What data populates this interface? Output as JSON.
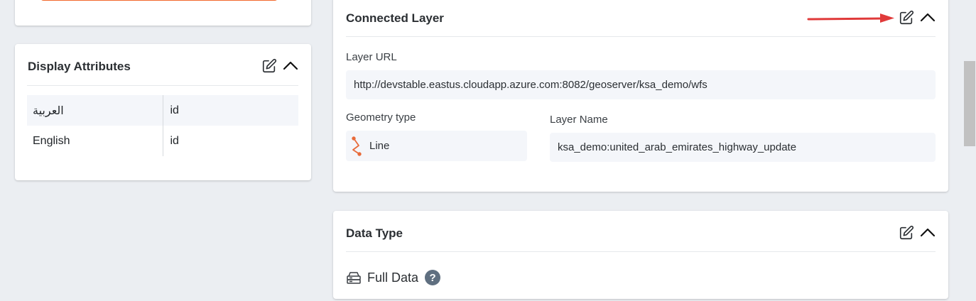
{
  "display_attributes": {
    "title": "Display Attributes",
    "rows": [
      {
        "key": "العربية",
        "value": "id"
      },
      {
        "key": "English",
        "value": "id"
      }
    ]
  },
  "connected_layer": {
    "title": "Connected Layer",
    "layer_url_label": "Layer URL",
    "layer_url_value": "http://devstable.eastus.cloudapp.azure.com:8082/geoserver/ksa_demo/wfs",
    "geometry_type_label": "Geometry type",
    "geometry_type_value": "Line",
    "layer_name_label": "Layer Name",
    "layer_name_value": "ksa_demo:united_arab_emirates_highway_update"
  },
  "data_type": {
    "title": "Data Type",
    "value": "Full Data",
    "help_glyph": "?"
  },
  "colors": {
    "accent_orange": "#f2692d",
    "annotation_arrow": "#e03a3a",
    "help_icon_bg": "#5f6f80"
  },
  "icons": {
    "edit": "edit-icon",
    "collapse": "chevron-up-icon",
    "geometry": "line-geometry-icon",
    "data": "database-icon",
    "help": "help-icon"
  }
}
